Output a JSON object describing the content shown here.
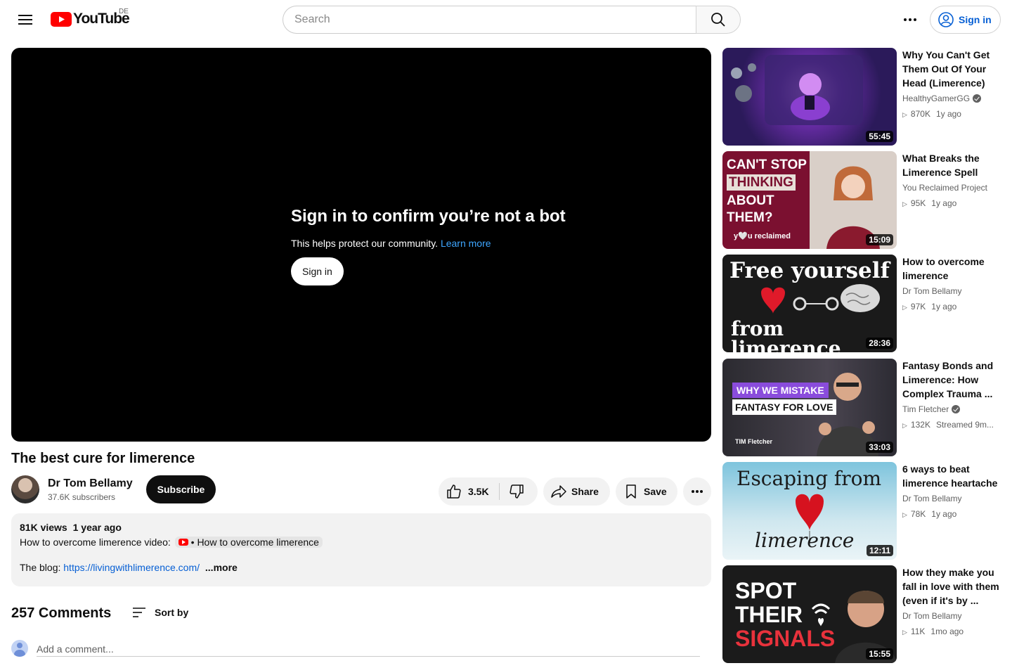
{
  "header": {
    "logo_text": "YouTube",
    "region": "DE",
    "search_placeholder": "Search",
    "sign_in_label": "Sign in"
  },
  "player": {
    "gate_title": "Sign in to confirm you’re not a bot",
    "gate_subtitle": "This helps protect our community.",
    "learn_more": "Learn more",
    "sign_in_button": "Sign in"
  },
  "video": {
    "title": "The best cure for limerence",
    "channel": "Dr Tom Bellamy",
    "subscribers": "37.6K subscribers",
    "subscribe_label": "Subscribe",
    "likes": "3.5K",
    "share_label": "Share",
    "save_label": "Save"
  },
  "description": {
    "views": "81K views",
    "age": "1 year ago",
    "line1_prefix": "How to overcome limerence video:",
    "chip_text": "• How to overcome limerence",
    "blog_prefix": "The blog:",
    "blog_link": "https://livingwithlimerence.com/",
    "more_label": "...more"
  },
  "comments": {
    "count_label": "257 Comments",
    "sort_label": "Sort by",
    "add_placeholder": "Add a comment..."
  },
  "recommendations": [
    {
      "title": "Why You Can't Get Them Out Of Your Head (Limerence)",
      "channel": "HealthyGamerGG",
      "verified": true,
      "views": "870K",
      "age": "1y ago",
      "duration": "55:45"
    },
    {
      "title": "What Breaks the Limerence Spell",
      "channel": "You Reclaimed Project",
      "verified": false,
      "views": "95K",
      "age": "1y ago",
      "duration": "15:09",
      "thumb_text": [
        "CAN'T STOP",
        "THINKING",
        "ABOUT",
        "THEM?"
      ],
      "thumb_brand": "y🤍u reclaimed"
    },
    {
      "title": "How to overcome limerence",
      "channel": "Dr Tom Bellamy",
      "verified": false,
      "views": "97K",
      "age": "1y ago",
      "duration": "28:36",
      "thumb_text": [
        "Free yourself",
        "from limerence"
      ]
    },
    {
      "title": "Fantasy Bonds and Limerence: How Complex Trauma ...",
      "channel": "Tim Fletcher",
      "verified": true,
      "views": "132K",
      "age": "Streamed 9m...",
      "duration": "33:03",
      "thumb_text": [
        "WHY WE MISTAKE",
        "FANTASY FOR LOVE"
      ],
      "thumb_brand": "TIM Fletcher"
    },
    {
      "title": "6 ways to beat limerence heartache",
      "channel": "Dr Tom Bellamy",
      "verified": false,
      "views": "78K",
      "age": "1y ago",
      "duration": "12:11",
      "thumb_text": [
        "Escaping from",
        "limerence"
      ]
    },
    {
      "title": "How they make you fall in love with them (even if it's by ...",
      "channel": "Dr Tom Bellamy",
      "verified": false,
      "views": "11K",
      "age": "1mo ago",
      "duration": "15:55",
      "thumb_text": [
        "SPOT",
        "THEIR",
        "SIGNALS"
      ]
    }
  ]
}
